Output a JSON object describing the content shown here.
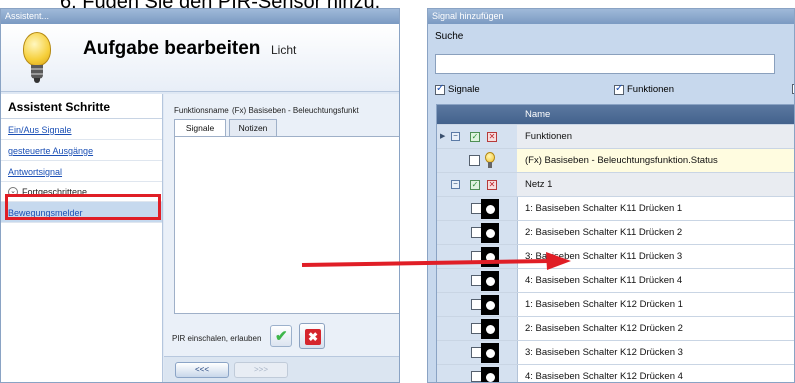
{
  "heading": "6.   Fügen Sie den PIR-Sensor hinzu.",
  "left_window": {
    "title": "Assistent...",
    "task_title": "Aufgabe bearbeiten",
    "task_subtitle": "Licht",
    "steps_title": "Assistent Schritte",
    "steps": [
      "Ein/Aus Signale",
      "gesteuerte Ausgänge",
      "Antwortsignal"
    ],
    "advanced_group": "Fortgeschrittene",
    "active_step": "Bewegungsmelder",
    "function_label": "Funktionsname",
    "function_value": "(Fx) Basiseben - Beleuchtungsfunkt",
    "tabs": [
      "Signale",
      "Notizen"
    ],
    "pir_label": "PIR einschalen, erlauben",
    "nav_prev": "<<<",
    "nav_next": ">>>"
  },
  "right_window": {
    "title": "Signal hinzufügen",
    "search_label": "Suche",
    "search_value": "",
    "filters": [
      {
        "label": "Signale",
        "checked": true
      },
      {
        "label": "Funktionen",
        "checked": true
      }
    ],
    "column_name": "Name",
    "group_functions": "Funktionen",
    "function_item": "(Fx) Basiseben - Beleuchtungsfunktion.Status",
    "group_network": "Netz 1",
    "items": [
      "1: Basiseben Schalter K11 Drücken 1",
      "2: Basiseben Schalter K11 Drücken 2",
      "3: Basiseben Schalter K11 Drücken 3",
      "4: Basiseben Schalter K11 Drücken 4",
      "1: Basiseben Schalter K12 Drücken 1",
      "2: Basiseben Schalter K12 Drücken 2",
      "3: Basiseben Schalter K12 Drücken 3",
      "4: Basiseben Schalter K12 Drücken 4"
    ]
  },
  "colors": {
    "highlight_box": "#e01e26",
    "arrow": "#e01e26",
    "grid_header": "#4b6a94"
  }
}
